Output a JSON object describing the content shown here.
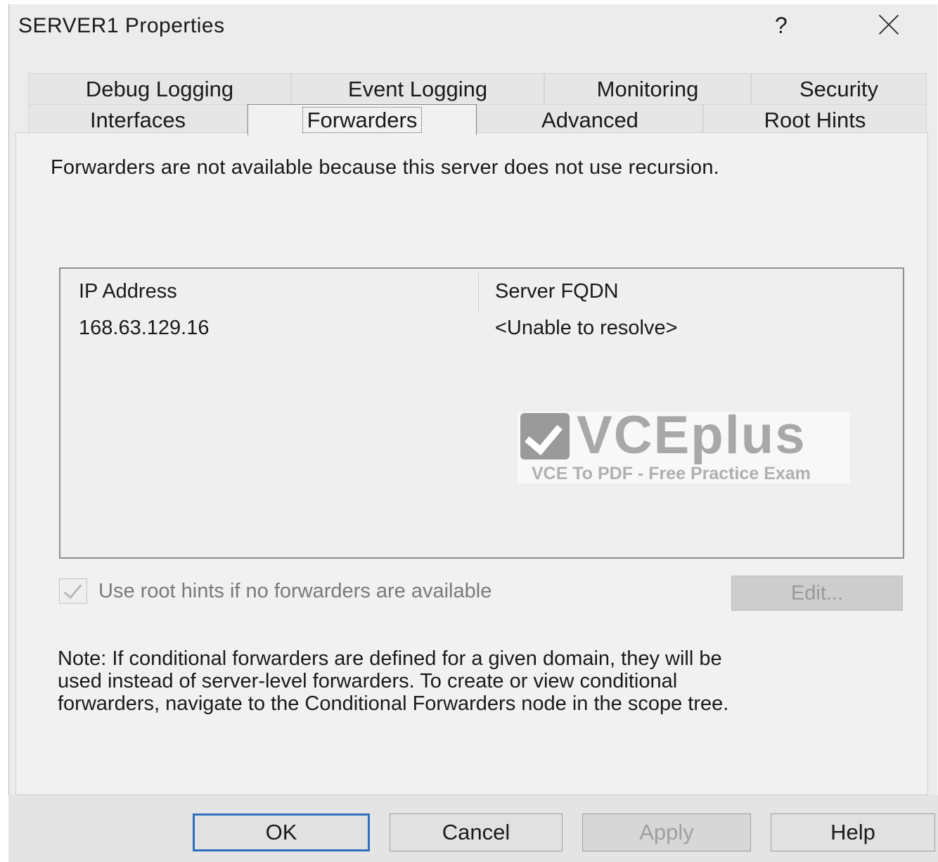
{
  "window": {
    "title": "SERVER1 Properties",
    "help_glyph": "?"
  },
  "tabs_top": [
    {
      "label": "Debug Logging"
    },
    {
      "label": "Event Logging"
    },
    {
      "label": "Monitoring"
    },
    {
      "label": "Security"
    }
  ],
  "tabs_bottom": [
    {
      "label": "Interfaces"
    },
    {
      "label": "Forwarders",
      "active": true
    },
    {
      "label": "Advanced"
    },
    {
      "label": "Root Hints"
    }
  ],
  "forwarders": {
    "message": "Forwarders are not available because this server does not use recursion.",
    "columns": [
      "IP Address",
      "Server FQDN"
    ],
    "rows": [
      {
        "ip": "168.63.129.16",
        "fqdn": "<Unable to resolve>"
      }
    ],
    "use_root_hints_label": "Use root hints if no forwarders are available",
    "use_root_hints_checked": true,
    "edit_label": "Edit...",
    "note_lines": [
      "Note: If conditional forwarders are defined for a given domain, they will be",
      "used instead of server-level forwarders.  To create or view conditional",
      "forwarders, navigate to the Conditional Forwarders node in the scope tree."
    ]
  },
  "watermark": {
    "brand": "VCEplus",
    "subtitle": "VCE To PDF - Free Practice Exam"
  },
  "buttons": {
    "ok": "OK",
    "cancel": "Cancel",
    "apply": "Apply",
    "help": "Help"
  }
}
